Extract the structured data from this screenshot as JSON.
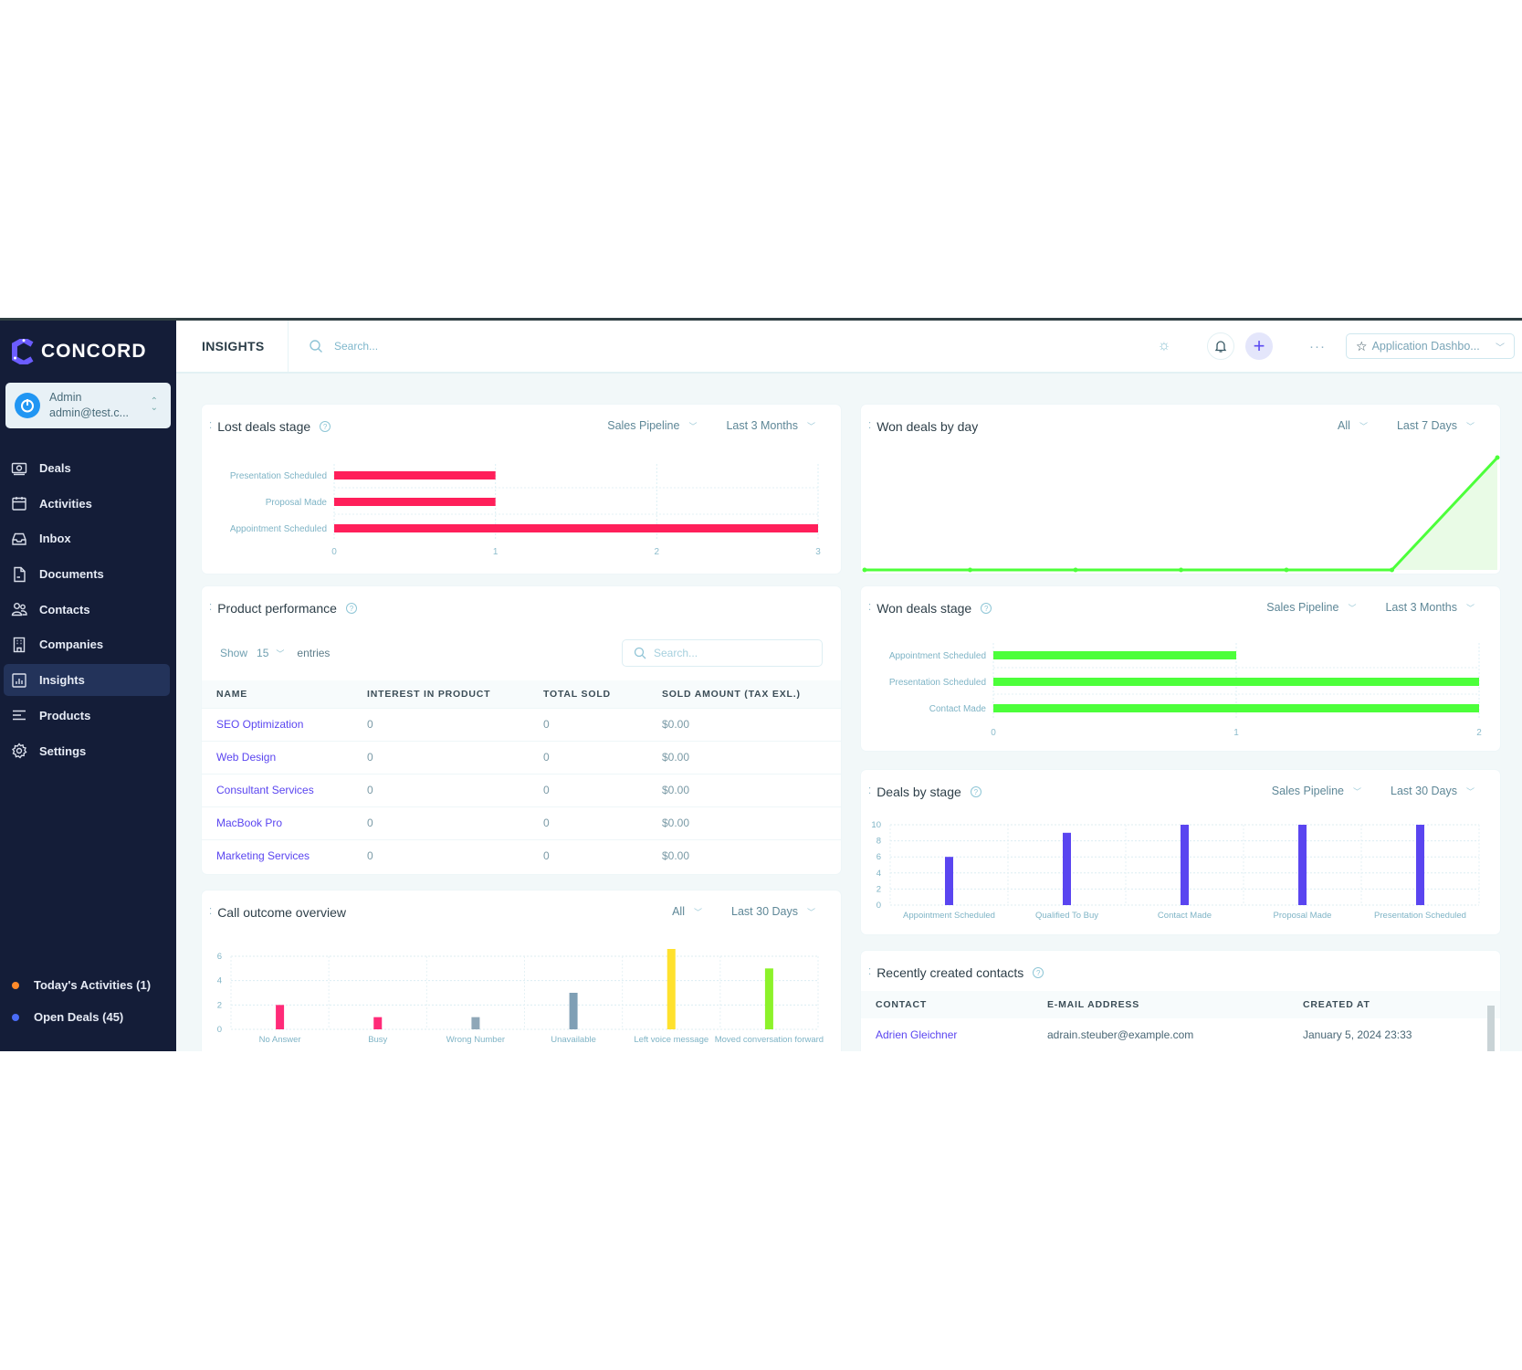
{
  "app": {
    "brand": "CONCORD",
    "page_title": "INSIGHTS",
    "search_placeholder": "Search...",
    "dashboard_select": "Application Dashbo...",
    "more_label": "···"
  },
  "colors": {
    "sidebar_bg": "#141d38",
    "accent": "#5a45f0",
    "lost_bar": "#ff1f5a",
    "won_green": "#4cff3a",
    "deals_bar": "#5a45f0"
  },
  "user": {
    "name": "Admin",
    "email": "admin@test.c..."
  },
  "sidebar": {
    "items": [
      {
        "label": "Deals",
        "icon": "deals-icon",
        "active": false
      },
      {
        "label": "Activities",
        "icon": "calendar-icon",
        "active": false
      },
      {
        "label": "Inbox",
        "icon": "inbox-icon",
        "active": false
      },
      {
        "label": "Documents",
        "icon": "document-icon",
        "active": false
      },
      {
        "label": "Contacts",
        "icon": "contacts-icon",
        "active": false
      },
      {
        "label": "Companies",
        "icon": "building-icon",
        "active": false
      },
      {
        "label": "Insights",
        "icon": "chart-icon",
        "active": true
      },
      {
        "label": "Products",
        "icon": "list-icon",
        "active": false
      },
      {
        "label": "Settings",
        "icon": "gear-icon",
        "active": false
      }
    ],
    "footer": [
      {
        "label": "Today's Activities (1)",
        "dot_color": "#ff8a2a"
      },
      {
        "label": "Open Deals (45)",
        "dot_color": "#4a6cf7"
      }
    ]
  },
  "cards": {
    "lost_deals": {
      "title": "Lost deals stage",
      "filter1": "Sales Pipeline",
      "filter2": "Last 3 Months"
    },
    "product_performance": {
      "title": "Product performance",
      "show_label": "Show",
      "show_value": "15",
      "entries_label": "entries",
      "search_placeholder": "Search...",
      "columns": [
        "NAME",
        "INTEREST IN PRODUCT",
        "TOTAL SOLD",
        "SOLD AMOUNT (TAX EXL.)"
      ],
      "rows": [
        [
          "SEO Optimization",
          "0",
          "0",
          "$0.00"
        ],
        [
          "Web Design",
          "0",
          "0",
          "$0.00"
        ],
        [
          "Consultant Services",
          "0",
          "0",
          "$0.00"
        ],
        [
          "MacBook Pro",
          "0",
          "0",
          "$0.00"
        ],
        [
          "Marketing Services",
          "0",
          "0",
          "$0.00"
        ]
      ]
    },
    "call_outcome": {
      "title": "Call outcome overview",
      "filter1": "All",
      "filter2": "Last 30 Days"
    },
    "won_by_day": {
      "title": "Won deals by day",
      "filter1": "All",
      "filter2": "Last 7 Days"
    },
    "won_stage": {
      "title": "Won deals stage",
      "filter1": "Sales Pipeline",
      "filter2": "Last 3 Months"
    },
    "deals_by_stage": {
      "title": "Deals by stage",
      "filter1": "Sales Pipeline",
      "filter2": "Last 30 Days"
    },
    "recent_contacts": {
      "title": "Recently created contacts",
      "columns": [
        "CONTACT",
        "E-MAIL ADDRESS",
        "CREATED AT"
      ],
      "rows": [
        [
          "Adrien Gleichner",
          "adrain.steuber@example.com",
          "January 5, 2024 23:33"
        ]
      ]
    }
  },
  "chart_data": [
    {
      "id": "lost_deals",
      "type": "bar",
      "orientation": "horizontal",
      "title": "Lost deals stage",
      "categories": [
        "Presentation Scheduled",
        "Proposal Made",
        "Appointment Scheduled"
      ],
      "values": [
        1,
        1,
        3
      ],
      "xlim": [
        0,
        3
      ],
      "xticks": [
        "0",
        "1",
        "2",
        "3"
      ],
      "color": "#ff1f5a",
      "grid": true
    },
    {
      "id": "call_outcome",
      "type": "bar",
      "title": "Call outcome overview",
      "categories": [
        "No Answer",
        "Busy",
        "Wrong Number",
        "Unavailable",
        "Left voice message",
        "Moved conversation forward"
      ],
      "values": [
        2,
        1,
        1,
        3,
        7,
        5
      ],
      "colors": [
        "#ff2b78",
        "#ff2b78",
        "#8fa7b8",
        "#7f9fb5",
        "#ffe12e",
        "#8cf22a"
      ],
      "ylim": [
        0,
        6
      ],
      "yticks": [
        "0",
        "2",
        "4",
        "6"
      ],
      "grid": true
    },
    {
      "id": "won_by_day",
      "type": "area",
      "title": "Won deals by day",
      "x": [
        1,
        2,
        3,
        4,
        5,
        6,
        7
      ],
      "values": [
        0,
        0,
        0,
        0,
        0,
        0,
        1
      ],
      "color": "#4cff3a",
      "grid": false
    },
    {
      "id": "won_stage",
      "type": "bar",
      "orientation": "horizontal",
      "title": "Won deals stage",
      "categories": [
        "Appointment Scheduled",
        "Presentation Scheduled",
        "Contact Made"
      ],
      "values": [
        1,
        2,
        2
      ],
      "xlim": [
        0,
        2
      ],
      "xticks": [
        "0",
        "1",
        "2"
      ],
      "color": "#4cff3a",
      "grid": true
    },
    {
      "id": "deals_by_stage",
      "type": "bar",
      "title": "Deals by stage",
      "categories": [
        "Appointment Scheduled",
        "Qualified To Buy",
        "Contact Made",
        "Proposal Made",
        "Presentation Scheduled"
      ],
      "values": [
        6,
        9,
        10,
        10,
        10
      ],
      "ylim": [
        0,
        10
      ],
      "yticks": [
        "0",
        "2",
        "4",
        "6",
        "8",
        "10"
      ],
      "color": "#5a45f0",
      "grid": true
    }
  ]
}
